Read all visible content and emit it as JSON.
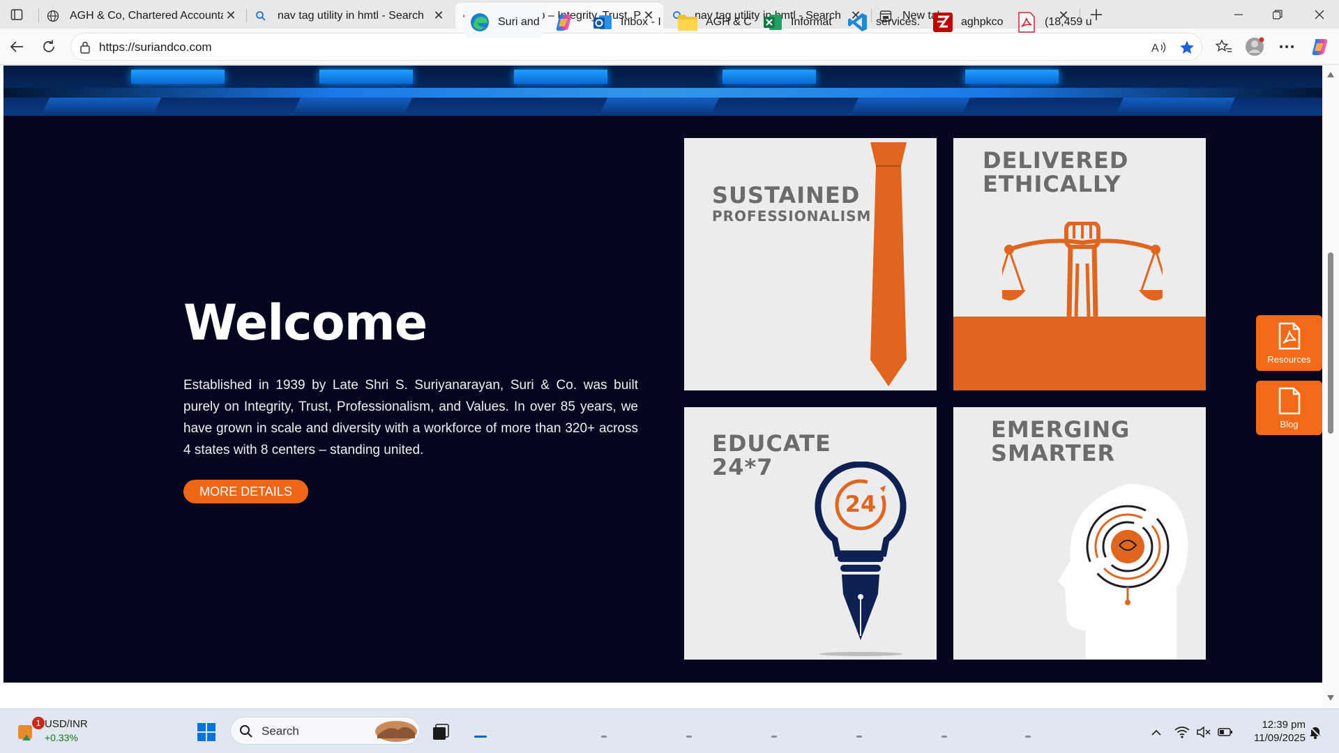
{
  "browser": {
    "tabs": [
      {
        "label": "AGH & Co, Chartered Accountants",
        "icon": "globe-icon"
      },
      {
        "label": "nav tag utility in hmtl - Search",
        "icon": "search-icon"
      },
      {
        "label": "Suri and Co – Integrity, Trust, Professionalism",
        "icon": "site-favicon"
      },
      {
        "label": "nav tag utility in hmtl - Search",
        "icon": "search-icon"
      },
      {
        "label": "New tab",
        "icon": "newtab-icon"
      }
    ],
    "url": "https://suriandco.com"
  },
  "page": {
    "welcome_heading": "Welcome",
    "intro_text": "Established in 1939 by Late Shri S. Suriyanarayan, Suri & Co. was built purely on Integrity, Trust, Professionalism, and Values. In over 85 years, we have grown in scale and diversity with a workforce of more than 320+ across 4 states with 8 centers –  standing united.",
    "more_details_label": "MORE DETAILS",
    "cards": [
      {
        "title_line1": "SUSTAINED",
        "title_line2": "PROFESSIONALISM"
      },
      {
        "title_line1": "DELIVERED",
        "title_line2": "ETHICALLY"
      },
      {
        "title_line1": "EDUCATE",
        "title_line2": "24*7",
        "badge": "24"
      },
      {
        "title_line1": "EMERGING",
        "title_line2": "SMARTER"
      }
    ],
    "side_buttons": [
      {
        "label": "Resources"
      },
      {
        "label": "Blog"
      }
    ],
    "accent_color": "#ee6616",
    "background_color": "#04051f"
  },
  "taskbar": {
    "widget_title": "USD/INR",
    "widget_change": "+0.33%",
    "widget_badge": "1",
    "search_placeholder": "Search",
    "apps": [
      {
        "label": "Suri and",
        "icon": "edge-icon"
      },
      {
        "label": "",
        "icon": "copilot-icon"
      },
      {
        "label": "Inbox - I",
        "icon": "outlook-icon"
      },
      {
        "label": "AGH & C",
        "icon": "folder-icon"
      },
      {
        "label": "Informat",
        "icon": "excel-icon"
      },
      {
        "label": "services.",
        "icon": "vscode-icon"
      },
      {
        "label": "aghpkco",
        "icon": "filezilla-icon"
      },
      {
        "label": "(18,459 u",
        "icon": "pdf-icon"
      }
    ],
    "time": "12:39 pm",
    "date": "11/09/2025"
  }
}
